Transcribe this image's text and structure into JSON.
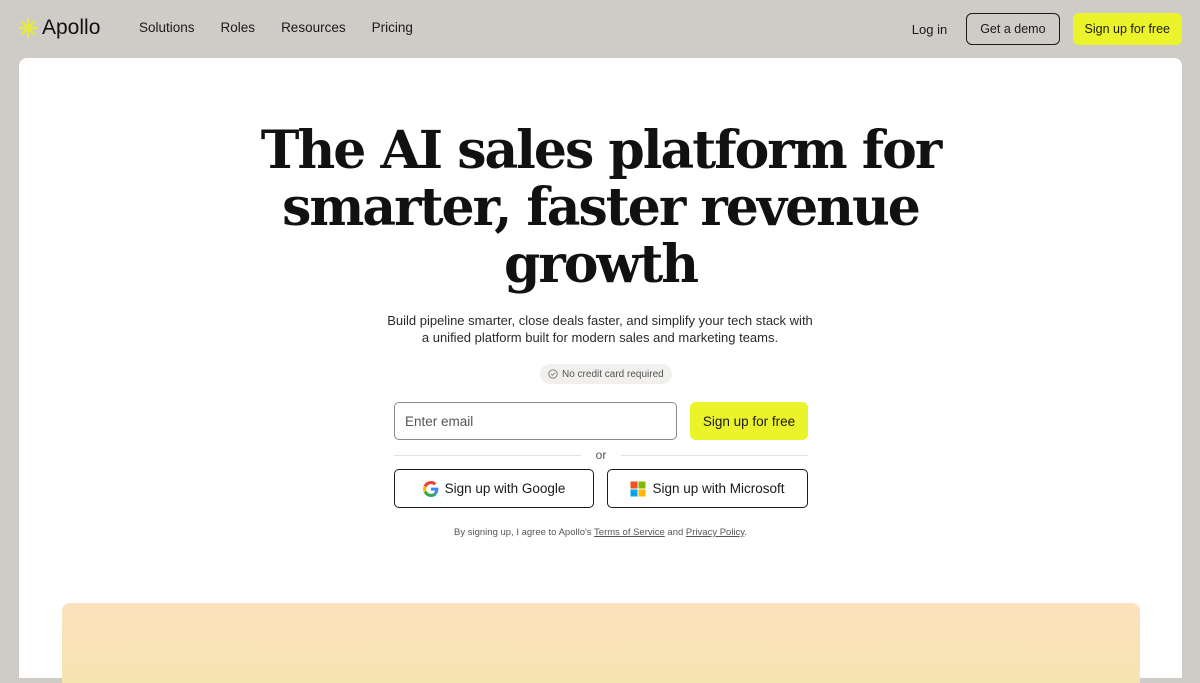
{
  "brand": {
    "name": "Apollo",
    "accent": "#ebf32b"
  },
  "nav": {
    "items": [
      {
        "label": "Solutions"
      },
      {
        "label": "Roles"
      },
      {
        "label": "Resources"
      },
      {
        "label": "Pricing"
      }
    ],
    "login_label": "Log in",
    "demo_label": "Get a demo",
    "signup_label": "Sign up for free"
  },
  "hero": {
    "title_line1": "The AI sales platform for",
    "title_line2": "smarter, faster revenue",
    "title_line3": "growth",
    "subtitle_line1": "Build pipeline smarter, close deals faster, and simplify your tech stack with",
    "subtitle_line2": "a unified platform built for modern sales and marketing teams.",
    "badge": "No credit card required"
  },
  "signup": {
    "email_placeholder": "Enter email",
    "submit_label": "Sign up for free",
    "or_label": "or",
    "google_label": "Sign up with Google",
    "microsoft_label": "Sign up with Microsoft",
    "terms_prefix": "By signing up, I agree to Apollo's",
    "terms_link": "Terms of Service",
    "terms_and": "and",
    "privacy_link": "Privacy Policy",
    "terms_suffix": "."
  },
  "icons": {
    "logo": "asterisk-icon",
    "badge": "check-circle-icon",
    "google": "google-icon",
    "microsoft": "microsoft-icon"
  }
}
